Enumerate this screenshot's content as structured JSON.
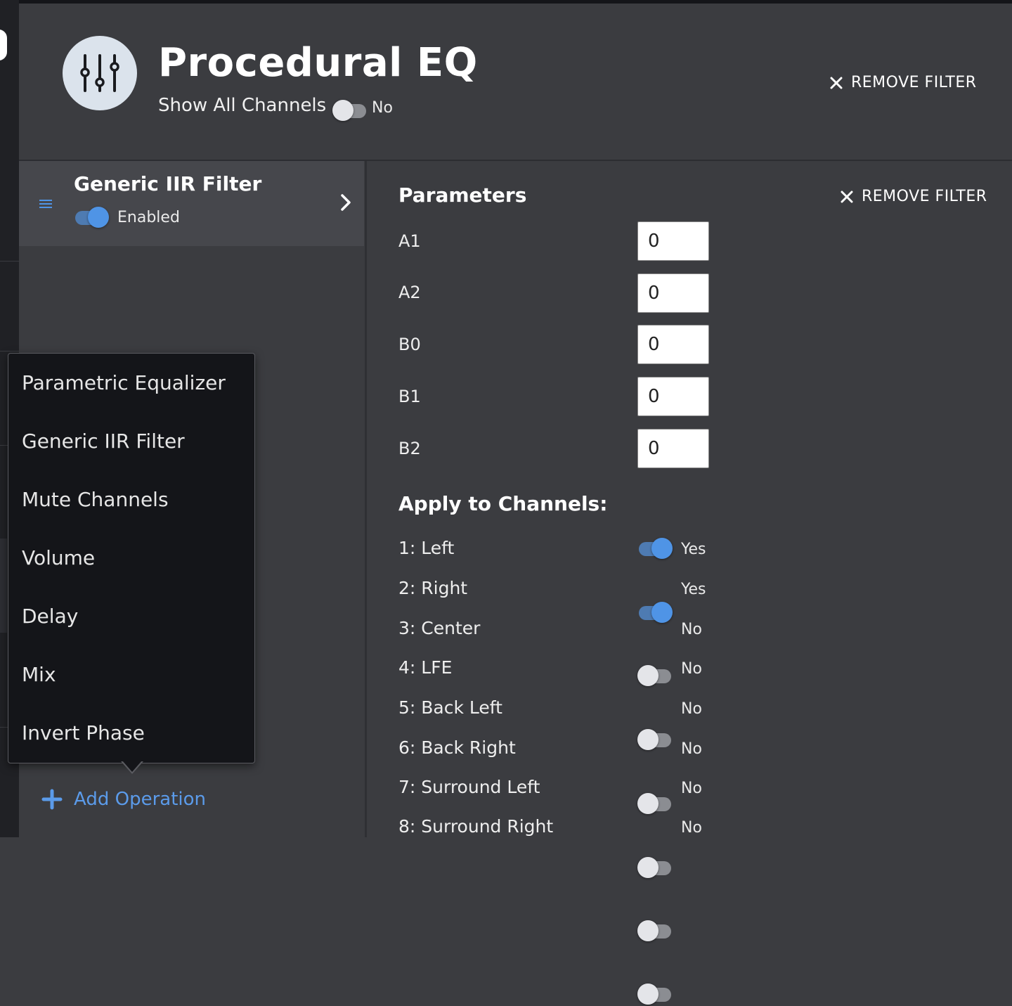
{
  "header": {
    "title": "Procedural EQ",
    "show_all_label": "Show All Channels",
    "show_all_value": "No",
    "remove_filter": "REMOVE FILTER"
  },
  "operation": {
    "title": "Generic IIR Filter",
    "enabled_label": "Enabled"
  },
  "add_operation": "Add Operation",
  "menu": {
    "items": [
      "Parametric Equalizer",
      "Generic IIR Filter",
      "Mute Channels",
      "Volume",
      "Delay",
      "Mix",
      "Invert Phase"
    ]
  },
  "parameters": {
    "title": "Parameters",
    "remove_filter": "REMOVE FILTER",
    "rows": [
      {
        "label": "A1",
        "value": "0"
      },
      {
        "label": "A2",
        "value": "0"
      },
      {
        "label": "B0",
        "value": "0"
      },
      {
        "label": "B1",
        "value": "0"
      },
      {
        "label": "B2",
        "value": "0"
      }
    ]
  },
  "channels": {
    "title": "Apply to Channels:",
    "items": [
      {
        "label": "1: Left",
        "value": "Yes"
      },
      {
        "label": "2: Right",
        "value": "Yes"
      },
      {
        "label": "3: Center",
        "value": "No"
      },
      {
        "label": "4: LFE",
        "value": "No"
      },
      {
        "label": "5: Back Left",
        "value": "No"
      },
      {
        "label": "6: Back Right",
        "value": "No"
      },
      {
        "label": "7: Surround Left",
        "value": "No"
      },
      {
        "label": "8: Surround Right",
        "value": "No"
      }
    ]
  },
  "colors": {
    "accent": "#4f94e6",
    "link": "#5b9bea",
    "background": "#3b3c40",
    "menu_background": "#141519"
  }
}
